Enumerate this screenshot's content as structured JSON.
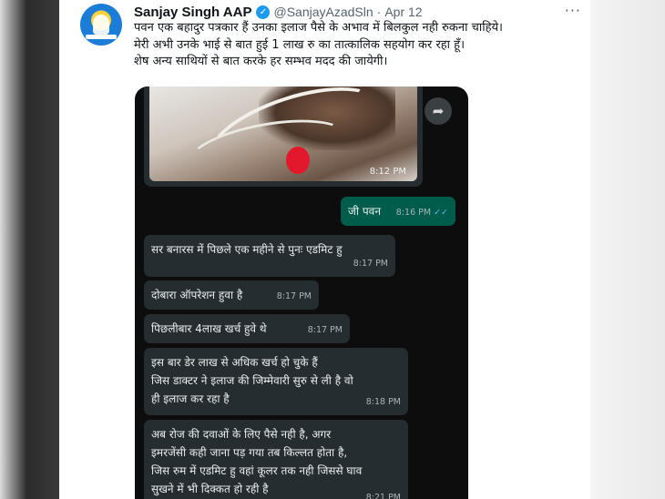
{
  "tweet": {
    "name": "Sanjay Singh AAP",
    "handle": "@SanjayAzadSln",
    "separator": "·",
    "date": "Apr 12",
    "more_icon": "···",
    "text_lines": [
      "पवन एक बहादुर पत्रकार हैं उनका इलाज पैसे के अभाव में बिलकुल नही रुकना चाहिये।",
      "मेरी अभी उनके भाई से बात हुई 1 लाख रु का तात्कालिक सहयोग कर रहा हूँ।",
      "शेष अन्य साथियों से बात करके हर सम्भव मदद की जायेगी।"
    ]
  },
  "chat": {
    "photo_time": "8:12 PM",
    "forward_icon": "➦",
    "messages": [
      {
        "direction": "out",
        "lines": [
          "जी पवन"
        ],
        "time": "8:16 PM",
        "ticks": "✓✓"
      },
      {
        "direction": "in",
        "lines": [
          "सर बनारस में पिछले एक महीने से पुनः एडमिट हु"
        ],
        "time": "8:17 PM"
      },
      {
        "direction": "in",
        "lines": [
          "दोबारा ऑपरेशन हुवा है"
        ],
        "time": "8:17 PM"
      },
      {
        "direction": "in",
        "lines": [
          "पिछलीबार 4लाख खर्च हुवे थे"
        ],
        "time": "8:17 PM"
      },
      {
        "direction": "in",
        "lines": [
          "इस बार डेर लाख से अधिक खर्च हो चुके हैं",
          "जिस डाक्टर ने इलाज की जिम्मेवारी सुरु से ली है वो",
          "ही इलाज कर रहा है"
        ],
        "time": "8:18 PM"
      },
      {
        "direction": "in",
        "lines": [
          "अब रोज की दवाओं के लिए पैसे नही है, अगर",
          "इमरजेंसी कही जाना पड़ गया तब किल्लत होता है,",
          "जिस रुम में एडमिट हु वहां कूलर तक नही जिससे घाव",
          "सुखने में भी दिक्कत हो रही है"
        ],
        "time": "8:21 PM"
      }
    ]
  },
  "colors": {
    "verified": "#1d9bf0",
    "outgoing_bubble": "#005c4b",
    "incoming_bubble": "#262d31",
    "read_ticks": "#53bdeb"
  }
}
